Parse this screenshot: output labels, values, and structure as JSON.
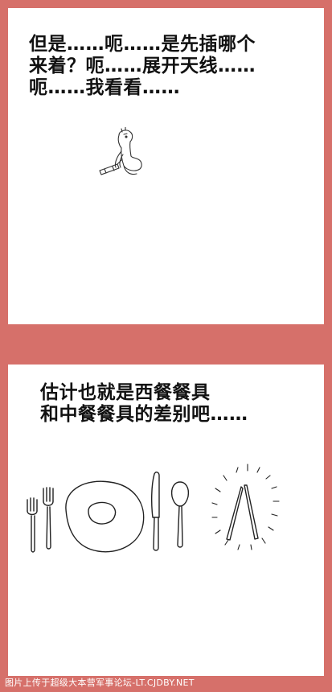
{
  "panels": [
    {
      "caption": "但是……呃……是先插哪个\n来着？呃……展开天线……\n呃……我看看……"
    },
    {
      "caption": "估计也就是西餐餐具\n和中餐餐具的差别吧……"
    }
  ],
  "watermark": "图片上传于超级大本营军事论坛-LT.CJDBY.NET",
  "colors": {
    "background": "#d6706a",
    "panel": "#ffffff",
    "ink": "#111111"
  }
}
